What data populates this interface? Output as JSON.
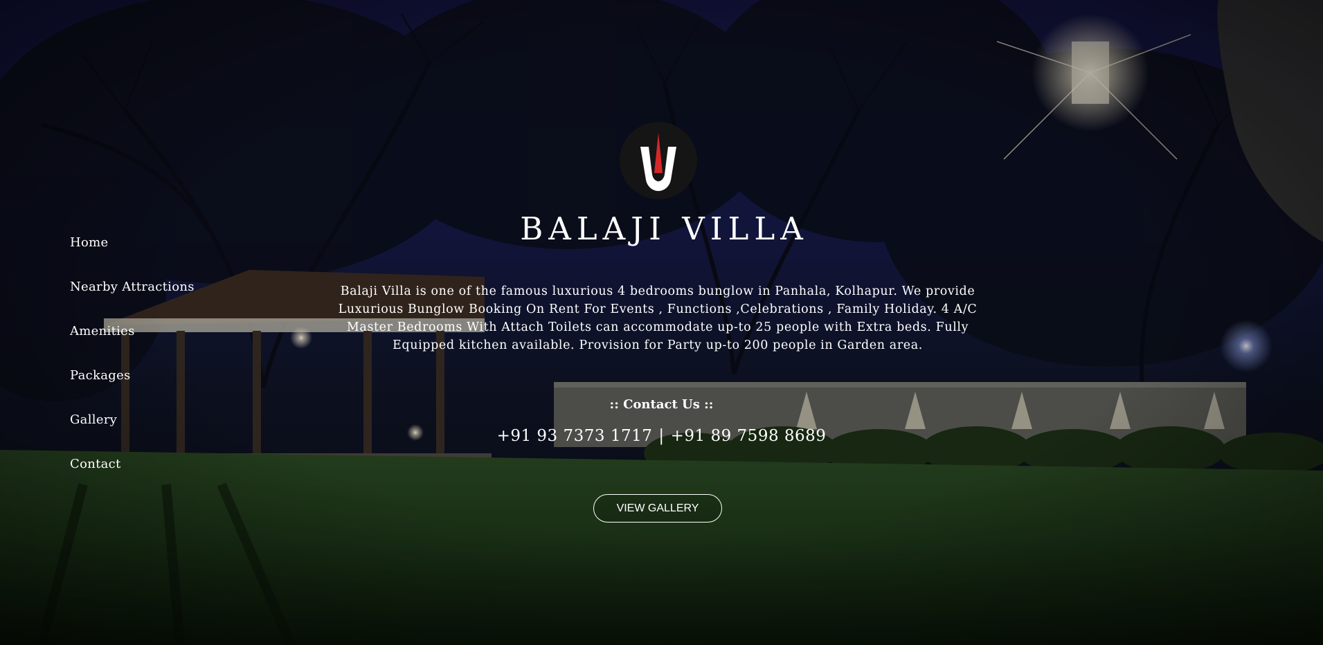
{
  "brand": {
    "logo_icon": "tilak-logo-icon",
    "title": "BALAJI VILLA",
    "colors": {
      "logo_background": "#151515",
      "logo_red": "#d62828",
      "logo_white": "#ffffff"
    }
  },
  "nav": {
    "items": [
      {
        "label": "Home"
      },
      {
        "label": "Nearby Attractions"
      },
      {
        "label": "Amenities"
      },
      {
        "label": "Packages"
      },
      {
        "label": "Gallery"
      },
      {
        "label": "Contact"
      }
    ]
  },
  "main": {
    "description": "Balaji Villa is one of the famous luxurious 4 bedrooms bunglow in Panhala, Kolhapur. We provide Luxurious Bunglow Booking On Rent For Events , Functions ,Celebrations , Family Holiday. 4 A/C Master Bedrooms With Attach Toilets can accommodate up-to 25 people with Extra beds. Fully Equipped kitchen available. Provision for Party up-to 200 people in Garden area.",
    "contact_heading": ":: Contact Us ::",
    "phone_1": "+91 93 7373 1717",
    "phone_separator": "|",
    "phone_2": "+91 89 7598 8689",
    "gallery_button": "VIEW GALLERY"
  }
}
